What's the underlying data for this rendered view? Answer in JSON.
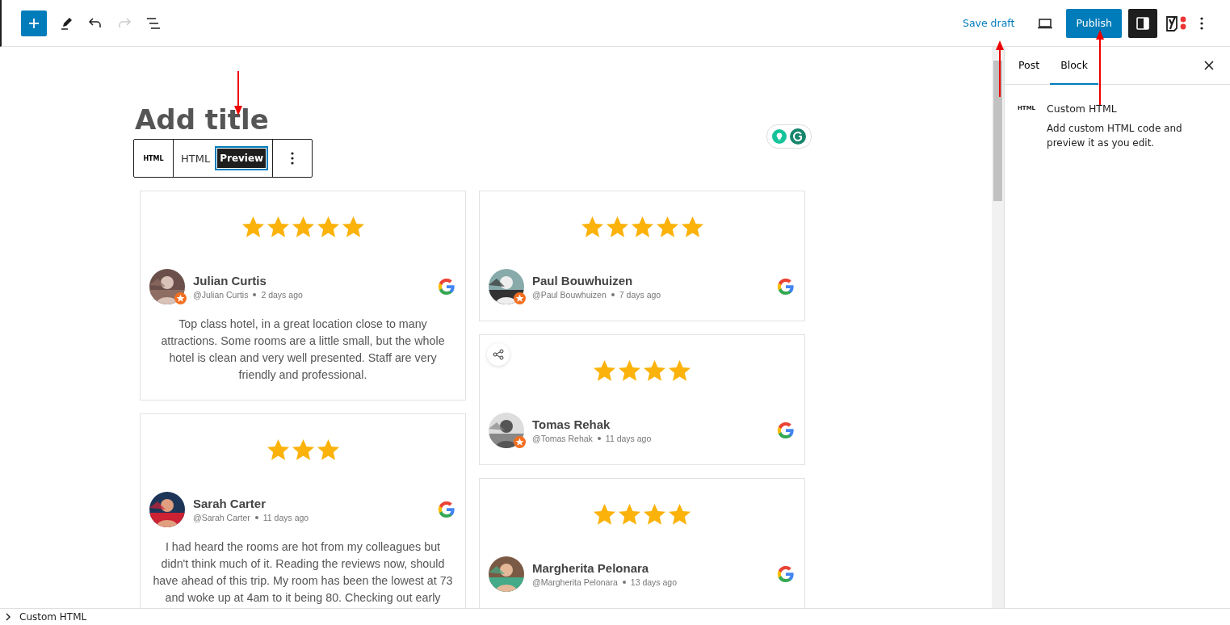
{
  "toolbar": {
    "undo_disabled": false,
    "redo_disabled": true,
    "save_draft": "Save draft",
    "publish": "Publish",
    "settings_selected": true
  },
  "block_toolbar": {
    "block_label": "HTML",
    "modes": [
      {
        "label": "HTML",
        "selected": false
      },
      {
        "label": "Preview",
        "selected": true
      }
    ]
  },
  "title": {
    "placeholder": "Add title"
  },
  "columns": [
    [
      {
        "stars": 5,
        "name": "Julian Curtis",
        "handle": "@Julian Curtis",
        "time": "2 days ago",
        "badge": true,
        "share": false,
        "text": "Top class hotel, in a great location close to many attractions. Some rooms are a little small, but the whole hotel is clean and very well presented. Staff are very friendly and professional."
      },
      {
        "stars": 3,
        "name": "Sarah Carter",
        "handle": "@Sarah Carter",
        "time": "11 days ago",
        "badge": false,
        "share": false,
        "text": "I had heard the rooms are hot from my colleagues but didn't think much of it. Reading the reviews now, should have ahead of this trip. My room has been the lowest at 73 and woke up at 4am to it being 80. Checking out early"
      }
    ],
    [
      {
        "stars": 5,
        "name": "Paul Bouwhuizen",
        "handle": "@Paul Bouwhuizen",
        "time": "7 days ago",
        "badge": true,
        "share": false
      },
      {
        "stars": 4,
        "name": "Tomas Rehak",
        "handle": "@Tomas Rehak",
        "time": "11 days ago",
        "badge": true,
        "share": true
      },
      {
        "stars": 4,
        "name": "Margherita Pelonara",
        "handle": "@Margherita Pelonara",
        "time": "13 days ago",
        "badge": false,
        "share": false
      }
    ]
  ],
  "sidebar": {
    "tabs": [
      {
        "label": "Post",
        "selected": false
      },
      {
        "label": "Block",
        "selected": true
      }
    ],
    "block_label": "HTML",
    "block_title": "Custom HTML",
    "block_description": "Add custom HTML code and preview it as you edit."
  },
  "status_bar": {
    "breadcrumb": "Custom HTML"
  }
}
